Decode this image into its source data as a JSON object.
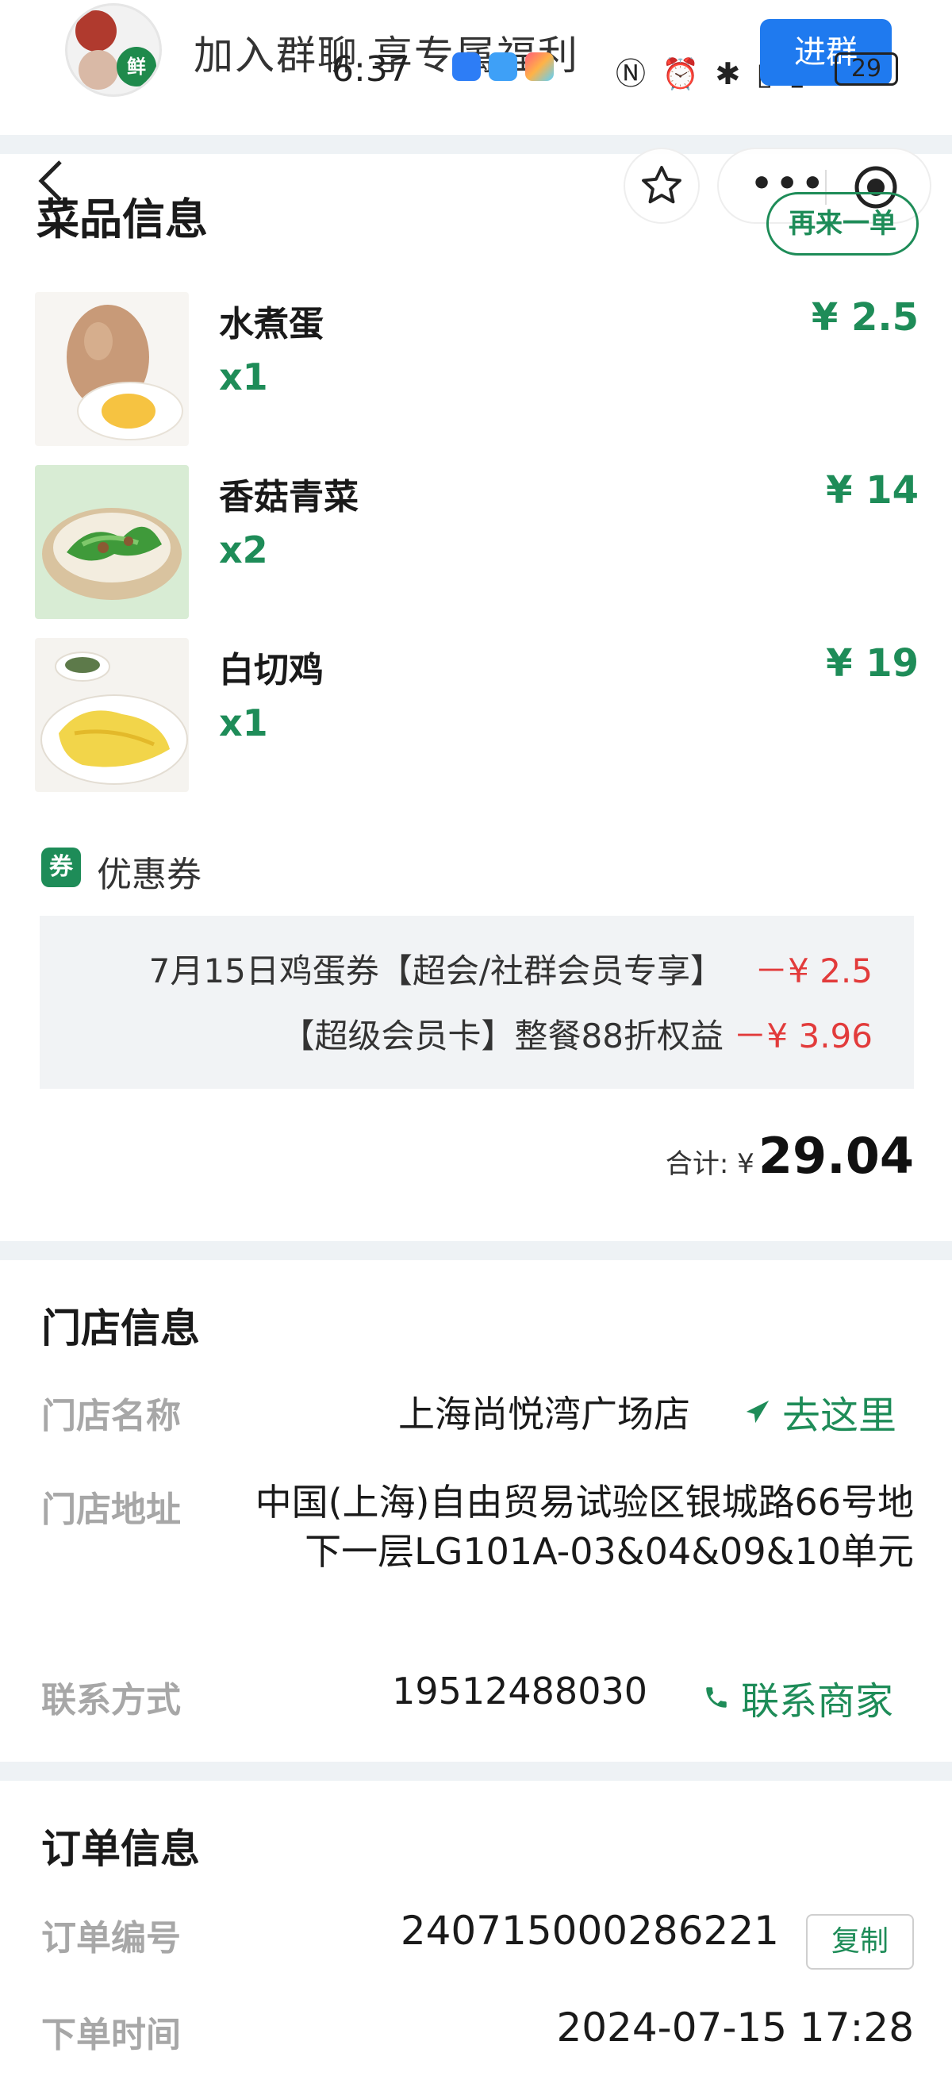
{
  "banner": {
    "text": "加入群聊 享专属福利",
    "join_label": "进群",
    "status_time": "6:37",
    "battery": "29"
  },
  "dishes_section": {
    "title": "菜品信息",
    "reorder_label": "再来一单",
    "items": [
      {
        "name": "水煮蛋",
        "qty": "x1",
        "price": "¥ 2.5"
      },
      {
        "name": "香菇青菜",
        "qty": "x2",
        "price": "¥ 14"
      },
      {
        "name": "白切鸡",
        "qty": "x1",
        "price": "¥ 19"
      }
    ]
  },
  "coupons": {
    "badge": "券",
    "label": "优惠券",
    "items": [
      {
        "name": "7月15日鸡蛋券【超会/社群会员专享】",
        "amount": "－¥ 2.5"
      },
      {
        "name": "【超级会员卡】整餐88折权益",
        "amount": "－¥ 3.96"
      }
    ],
    "total_label": "合计: ¥",
    "total_value": "29.04"
  },
  "store": {
    "title": "门店信息",
    "name_label": "门店名称",
    "name_value": "上海尚悦湾广场店",
    "go_label": "去这里",
    "address_label": "门店地址",
    "address_value": "中国(上海)自由贸易试验区银城路66号地下一层LG101A-03&04&09&10单元",
    "contact_label": "联系方式",
    "contact_value": "19512488030",
    "contact_action": "联系商家"
  },
  "order": {
    "title": "订单信息",
    "number_label": "订单编号",
    "number_value": "240715000286221",
    "copy_label": "复制",
    "time_label": "下单时间",
    "time_value": "2024-07-15 17:28"
  },
  "colors": {
    "accent_green": "#1e8c58",
    "discount_red": "#e23b3b",
    "join_blue": "#1f7aef"
  }
}
